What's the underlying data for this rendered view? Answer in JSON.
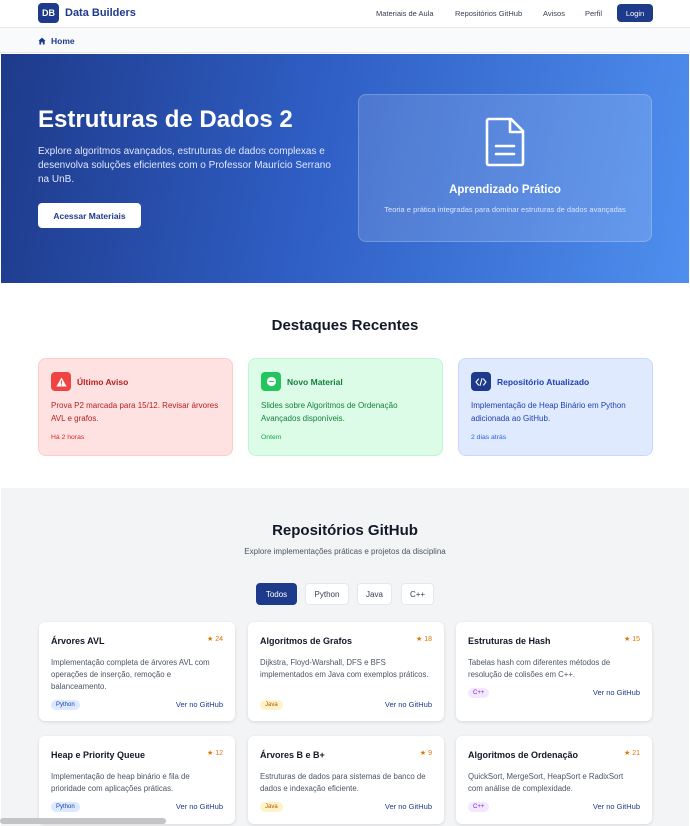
{
  "navbar": {
    "logo": "DB",
    "brand": "Data Builders",
    "links": [
      "Materiais de Aula",
      "Repositórios GitHub",
      "Avisos",
      "Perfil"
    ],
    "login": "Login"
  },
  "breadcrumb": {
    "home": "Home"
  },
  "hero": {
    "title": "Estruturas de Dados 2",
    "description": "Explore algoritmos avançados, estruturas de dados complexas e desenvolva soluções eficientes com o Professor Maurício Serrano na UnB.",
    "button": "Acessar Materiais",
    "card_title": "Aprendizado Prático",
    "card_desc": "Teoria e prática integradas para dominar estruturas de dados avançadas"
  },
  "highlights": {
    "title": "Destaques Recentes",
    "items": [
      {
        "title": "Último Aviso",
        "desc": "Prova P2 marcada para 15/12. Revisar árvores AVL e grafos.",
        "time": "Há 2 horas",
        "icon": "alert-triangle-icon",
        "color": "#dc2626"
      },
      {
        "title": "Novo Material",
        "desc": "Slides sobre Algoritmos de Ordenação Avançados disponíveis.",
        "time": "Ontem",
        "icon": "chat-bubble-icon",
        "color": "#16a34a"
      },
      {
        "title": "Repositório Atualizado",
        "desc": "Implementação de Heap Binário em Python adicionada ao GitHub.",
        "time": "2 dias atrás",
        "icon": "code-icon",
        "color": "#1e3a8a"
      }
    ]
  },
  "github": {
    "title": "Repositórios GitHub",
    "subtitle": "Explore implementações práticas e projetos da disciplina",
    "filters": [
      "Todos",
      "Python",
      "Java",
      "C++"
    ],
    "active_filter": "Todos",
    "link_label": "Ver no GitHub",
    "repos": [
      {
        "name": "Árvores AVL",
        "stars": "24",
        "desc": "Implementação completa de árvores AVL com operações de inserção, remoção e balanceamento.",
        "lang": "Python"
      },
      {
        "name": "Algoritmos de Grafos",
        "stars": "18",
        "desc": "Dijkstra, Floyd-Warshall, DFS e BFS implementados em Java com exemplos práticos.",
        "lang": "Java"
      },
      {
        "name": "Estruturas de Hash",
        "stars": "15",
        "desc": "Tabelas hash com diferentes métodos de resolução de colisões em C++.",
        "lang": "C++"
      },
      {
        "name": "Heap e Priority Queue",
        "stars": "12",
        "desc": "Implementação de heap binário e fila de prioridade com aplicações práticas.",
        "lang": "Python"
      },
      {
        "name": "Árvores B e B+",
        "stars": "9",
        "desc": "Estruturas de dados para sistemas de banco de dados e indexação eficiente.",
        "lang": "Java"
      },
      {
        "name": "Algoritmos de Ordenação",
        "stars": "21",
        "desc": "QuickSort, MergeSort, HeapSort e RadixSort com análise de complexidade.",
        "lang": "C++"
      }
    ]
  }
}
